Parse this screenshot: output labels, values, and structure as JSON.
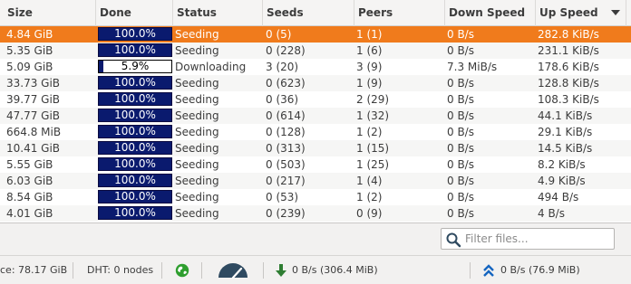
{
  "columns": {
    "size": "Size",
    "done": "Done",
    "status": "Status",
    "seeds": "Seeds",
    "peers": "Peers",
    "down_speed": "Down Speed",
    "up_speed": "Up Speed"
  },
  "rows": [
    {
      "size": "4.84 GiB",
      "done": "100.0%",
      "progress": 1.0,
      "status": "Seeding",
      "seeds": "0 (5)",
      "peers": "1 (1)",
      "down": "0 B/s",
      "up": "282.8 KiB/s",
      "selected": true
    },
    {
      "size": "5.35 GiB",
      "done": "100.0%",
      "progress": 1.0,
      "status": "Seeding",
      "seeds": "0 (228)",
      "peers": "1 (6)",
      "down": "0 B/s",
      "up": "231.1 KiB/s"
    },
    {
      "size": "5.09 GiB",
      "done": "5.9%",
      "progress": 0.059,
      "status": "Downloading",
      "seeds": "3 (20)",
      "peers": "3 (9)",
      "down": "7.3 MiB/s",
      "up": "178.6 KiB/s"
    },
    {
      "size": "33.73 GiB",
      "done": "100.0%",
      "progress": 1.0,
      "status": "Seeding",
      "seeds": "0 (623)",
      "peers": "1 (9)",
      "down": "0 B/s",
      "up": "128.8 KiB/s"
    },
    {
      "size": "39.77 GiB",
      "done": "100.0%",
      "progress": 1.0,
      "status": "Seeding",
      "seeds": "0 (36)",
      "peers": "2 (29)",
      "down": "0 B/s",
      "up": "108.3 KiB/s"
    },
    {
      "size": "47.77 GiB",
      "done": "100.0%",
      "progress": 1.0,
      "status": "Seeding",
      "seeds": "0 (614)",
      "peers": "1 (32)",
      "down": "0 B/s",
      "up": "44.1 KiB/s"
    },
    {
      "size": "664.8 MiB",
      "done": "100.0%",
      "progress": 1.0,
      "status": "Seeding",
      "seeds": "0 (128)",
      "peers": "1 (2)",
      "down": "0 B/s",
      "up": "29.1 KiB/s"
    },
    {
      "size": "10.41 GiB",
      "done": "100.0%",
      "progress": 1.0,
      "status": "Seeding",
      "seeds": "0 (313)",
      "peers": "1 (15)",
      "down": "0 B/s",
      "up": "14.5 KiB/s"
    },
    {
      "size": "5.55 GiB",
      "done": "100.0%",
      "progress": 1.0,
      "status": "Seeding",
      "seeds": "0 (503)",
      "peers": "1 (25)",
      "down": "0 B/s",
      "up": "8.2 KiB/s"
    },
    {
      "size": "6.03 GiB",
      "done": "100.0%",
      "progress": 1.0,
      "status": "Seeding",
      "seeds": "0 (217)",
      "peers": "1 (4)",
      "down": "0 B/s",
      "up": "4.9 KiB/s"
    },
    {
      "size": "8.54 GiB",
      "done": "100.0%",
      "progress": 1.0,
      "status": "Seeding",
      "seeds": "0 (53)",
      "peers": "1 (2)",
      "down": "0 B/s",
      "up": "494 B/s"
    },
    {
      "size": "4.01 GiB",
      "done": "100.0%",
      "progress": 1.0,
      "status": "Seeding",
      "seeds": "0 (239)",
      "peers": "0 (9)",
      "down": "0 B/s",
      "up": "4 B/s"
    }
  ],
  "filter": {
    "placeholder": "Filter files...",
    "value": ""
  },
  "statusbar": {
    "free_space": "ce: 78.17 GiB",
    "dht": "DHT: 0 nodes",
    "download": "0 B/s (306.4 MiB)",
    "upload": "0 B/s (76.9 MiB)"
  },
  "colors": {
    "selected_row": "#f07b1c",
    "progress_fill": "#0a1a6e",
    "globe_icon": "#2e9e2e",
    "download_arrow": "#2e7d32",
    "upload_arrow": "#1565c0",
    "speed_gauge": "#2f4a60"
  },
  "icons": {
    "filter": "search-icon",
    "network": "globe-icon",
    "speed_limit": "gauge-icon",
    "download": "down-arrow-icon",
    "upload": "double-up-arrow-icon"
  }
}
